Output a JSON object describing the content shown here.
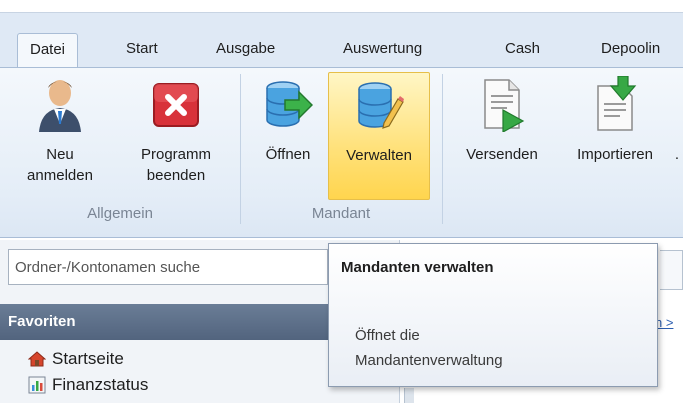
{
  "ribbon_tabs": [
    {
      "label": "Datei",
      "active": true
    },
    {
      "label": "Start",
      "active": false
    },
    {
      "label": "Ausgabe",
      "active": false
    },
    {
      "label": "Auswertung",
      "active": false
    },
    {
      "label": "Cash",
      "active": false
    },
    {
      "label": "Depoolin",
      "active": false
    }
  ],
  "buttons": {
    "neu_anmelden": {
      "line1": "Neu",
      "line2": "anmelden",
      "icon": "user-icon"
    },
    "programm_beenden": {
      "line1": "Programm",
      "line2": "beenden",
      "icon": "close-icon"
    },
    "oeffnen": {
      "line1": "Öffnen",
      "icon": "open-database-icon"
    },
    "verwalten": {
      "line1": "Verwalten",
      "icon": "edit-database-icon",
      "highlighted": true
    },
    "versenden": {
      "line1": "Versenden",
      "icon": "send-document-icon"
    },
    "importieren": {
      "line1": "Importieren",
      "icon": "import-document-icon"
    },
    "more": "."
  },
  "groups": {
    "allgemein": "Allgemein",
    "mandant": "Mandant"
  },
  "search": {
    "value": "Ordner-/Kontonamen suche"
  },
  "favoriten": {
    "title": "Favoriten",
    "items": [
      {
        "label": "Startseite",
        "icon": "home-icon"
      },
      {
        "label": "Finanzstatus",
        "icon": "bar-chart-icon"
      }
    ]
  },
  "right_link": "n >",
  "tooltip": {
    "title": "Mandanten verwalten",
    "description": "Öffnet die\nMandantenverwaltung"
  },
  "colors": {
    "highlight": "#ffd54e",
    "tab_bar": "#dfe9f5",
    "favoriten_header": "#5a6c85",
    "link": "#2a5db0"
  }
}
